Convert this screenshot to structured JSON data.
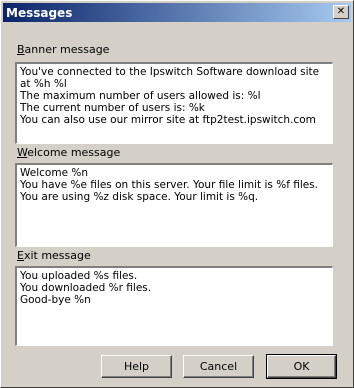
{
  "window": {
    "title": "Messages",
    "close_glyph": "✕"
  },
  "banner": {
    "label_accel": "B",
    "label_rest": "anner message",
    "lines": [
      "You've connected to the Ipswitch Software download site",
      "at %h %l",
      "The maximum number of users allowed is: %l",
      "The current number of users is: %k",
      "You can also use our mirror site at ftp2test.ipswitch.com"
    ]
  },
  "welcome": {
    "label_accel": "W",
    "label_rest": "elcome message",
    "lines": [
      "Welcome %n",
      "You have %e files on this server. Your file limit is %f files.",
      "You are using %z disk space. Your limit is %q."
    ]
  },
  "exit": {
    "label_accel": "E",
    "label_rest": "xit message",
    "lines": [
      "You uploaded %s files.",
      "You downloaded %r files.",
      "Good-bye %n"
    ]
  },
  "buttons": {
    "help": "Help",
    "cancel": "Cancel",
    "ok": "OK"
  }
}
